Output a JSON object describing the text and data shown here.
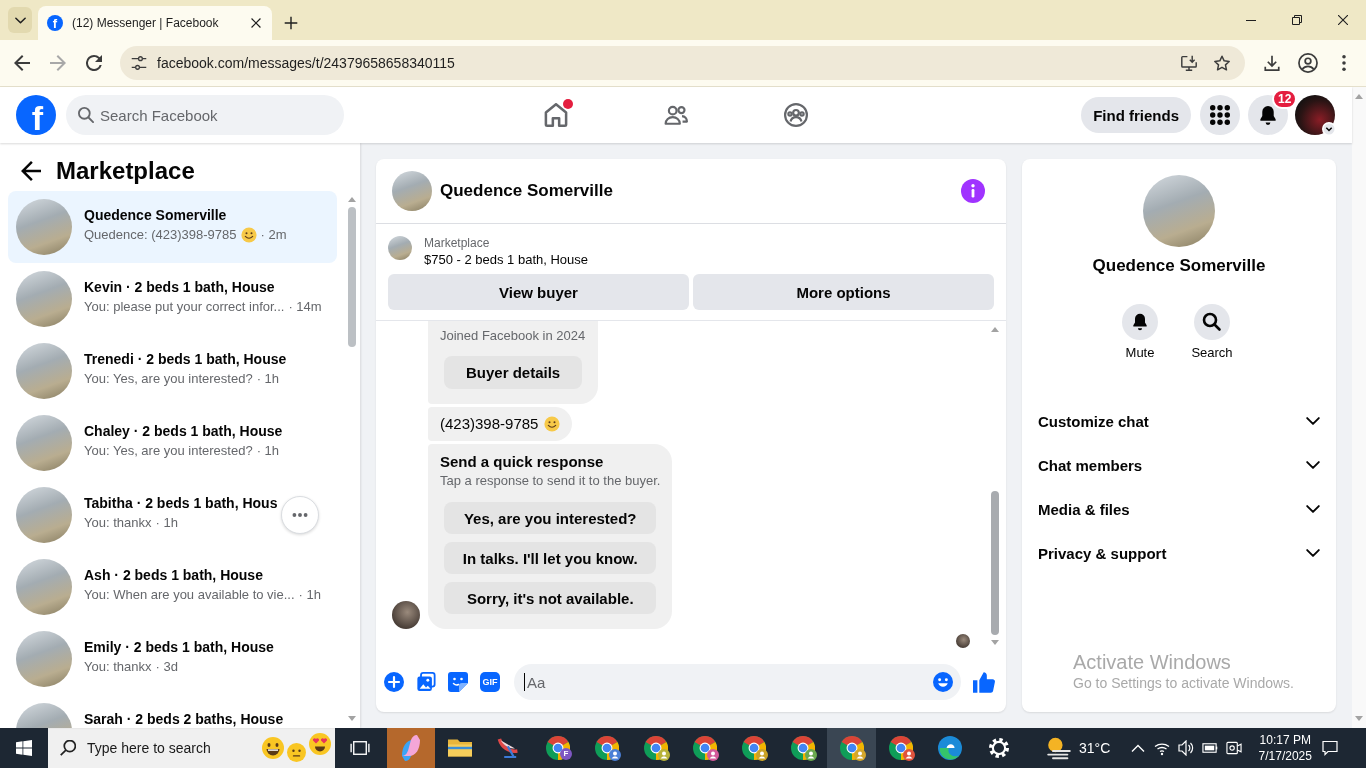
{
  "browser": {
    "tabs": [
      {
        "favicon": "f",
        "title": "(12) Messenger | Facebook",
        "selected": true
      }
    ],
    "url": "facebook.com/messages/t/24379658658340115"
  },
  "header": {
    "logo": "f",
    "search": {
      "placeholder": "Search Facebook"
    },
    "nav": [
      {
        "kind": "home",
        "selected": false,
        "dot": true
      },
      {
        "kind": "friends",
        "selected": false,
        "dot": false
      },
      {
        "kind": "groups",
        "selected": false,
        "dot": false
      }
    ],
    "find_friends": "Find friends",
    "notifications": {
      "badge": "12"
    }
  },
  "sidebar": {
    "title": "Marketplace",
    "conversations": [
      {
        "name": "Quedence Somerville",
        "preview": "Quedence: (423)398-9785",
        "emoji": true,
        "time": "· 2m",
        "selected": true,
        "more_button": false
      },
      {
        "name": "Kevin · 2 beds 1 bath, House",
        "preview": "You: please put your correct infor...",
        "emoji": false,
        "time": "· 14m",
        "selected": false,
        "more_button": false
      },
      {
        "name": "Trenedi · 2 beds 1 bath, House",
        "preview": "You: Yes, are you interested?",
        "emoji": false,
        "time": "· 1h",
        "selected": false,
        "more_button": false
      },
      {
        "name": "Chaley · 2 beds 1 bath, House",
        "preview": "You: Yes, are you interested?",
        "emoji": false,
        "time": "· 1h",
        "selected": false,
        "more_button": false
      },
      {
        "name": "Tabitha · 2 beds 1 bath, Hous",
        "preview": "You: thankx",
        "emoji": false,
        "time": "· 1h",
        "selected": false,
        "more_button": true
      },
      {
        "name": "Ash · 2 beds 1 bath, House",
        "preview": "You: When are you available to vie...",
        "emoji": false,
        "time": "· 1h",
        "selected": false,
        "more_button": false
      },
      {
        "name": "Emily · 2 beds 1 bath, House",
        "preview": "You: thankx",
        "emoji": false,
        "time": "· 3d",
        "selected": false,
        "more_button": false
      },
      {
        "name": "Sarah · 2 beds 2 baths, House",
        "emoji": false,
        "selected": false,
        "more_button": false
      }
    ]
  },
  "chat": {
    "name": "Quedence Somerville",
    "listing": {
      "label": "Marketplace",
      "title": "$750 - 2 beds 1 bath, House"
    },
    "actions": [
      "View buyer",
      "More options"
    ],
    "messages": [
      {
        "kind": "profile",
        "text": "Joined Facebook in 2024",
        "button": "Buyer details"
      },
      {
        "kind": "text",
        "text": "(423)398-9785",
        "emoji": true
      },
      {
        "kind": "quick_replies",
        "title": "Send a quick response",
        "subtitle": "Tap a response to send it to the buyer.",
        "options": [
          "Yes, are you interested?",
          "In talks. I'll let you know.",
          "Sorry, it's not available."
        ]
      }
    ],
    "composer": {
      "gif": "GIF",
      "placeholder": "Aa",
      "focused": true
    }
  },
  "details": {
    "name": "Quedence Somerville",
    "actions": [
      {
        "kind": "mute",
        "label": "Mute"
      },
      {
        "kind": "search",
        "label": "Search"
      }
    ],
    "sections": [
      {
        "label": "Customize chat",
        "expanded": false
      },
      {
        "label": "Chat members",
        "expanded": false
      },
      {
        "label": "Media & files",
        "expanded": false
      },
      {
        "label": "Privacy & support",
        "expanded": false
      }
    ]
  },
  "activation_notice": {
    "title": "Activate Windows",
    "message": "Go to Settings to activate Windows."
  },
  "taskbar": {
    "search": {
      "placeholder": "Type here to search"
    },
    "apps": [
      {
        "kind": "swirl",
        "selected": false
      },
      {
        "kind": "folder",
        "selected": false
      },
      {
        "kind": "dish",
        "selected": false
      },
      {
        "kind": "browser",
        "badge": "F",
        "color": "#7e57c2",
        "selected": false
      },
      {
        "kind": "browser",
        "color": "#4a7fd6",
        "selected": false
      },
      {
        "kind": "browser",
        "color": "#b7b23a",
        "selected": false
      },
      {
        "kind": "browser",
        "color": "#d45a9b",
        "selected": false
      },
      {
        "kind": "browser",
        "color": "#c9a227",
        "selected": false
      },
      {
        "kind": "browser",
        "color": "#6aa84f",
        "selected": false
      },
      {
        "kind": "browser",
        "color": "#d4a72c",
        "selected": true
      },
      {
        "kind": "browser",
        "color": "#e0533e",
        "selected": false
      },
      {
        "kind": "wave",
        "selected": false
      },
      {
        "kind": "gear",
        "selected": false
      }
    ],
    "weather": "31°C",
    "time": "10:17 PM",
    "date": "7/17/2025"
  }
}
